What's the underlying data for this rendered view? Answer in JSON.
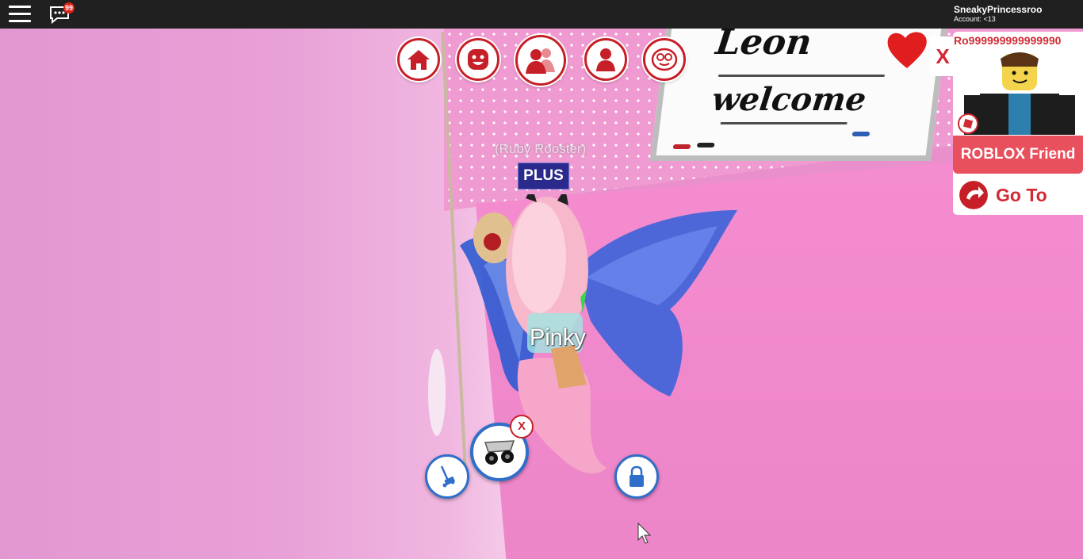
{
  "topbar": {
    "chat_badge": "99",
    "username": "SneakyPrincessroo",
    "account": "Account: <13"
  },
  "menu": {
    "buttons": [
      {
        "icon": "home-icon"
      },
      {
        "icon": "emote-icon"
      },
      {
        "icon": "friends-icon"
      },
      {
        "icon": "avatar-icon"
      },
      {
        "icon": "face-icon"
      }
    ]
  },
  "character": {
    "rank_text": "(Ruby Rooster)",
    "badge": "PLUS",
    "name": "Pinky"
  },
  "whiteboard": {
    "line1": "Leon",
    "line2": "welcome"
  },
  "friend_panel": {
    "close_label": "X",
    "player_name": "Ro999999999999990",
    "friend_button": "ROBLOX Friend",
    "goto_button": "Go To"
  },
  "vehicle_tools": {
    "close_label": "X",
    "left_icon": "wagon-icon",
    "center_icon": "stroller-icon",
    "right_icon": "lock-icon"
  },
  "colors": {
    "accent_red": "#c71f28",
    "friend_button": "#e8505e",
    "plus_badge": "#2a2a8c",
    "tool_ring": "#2f6fc9"
  }
}
